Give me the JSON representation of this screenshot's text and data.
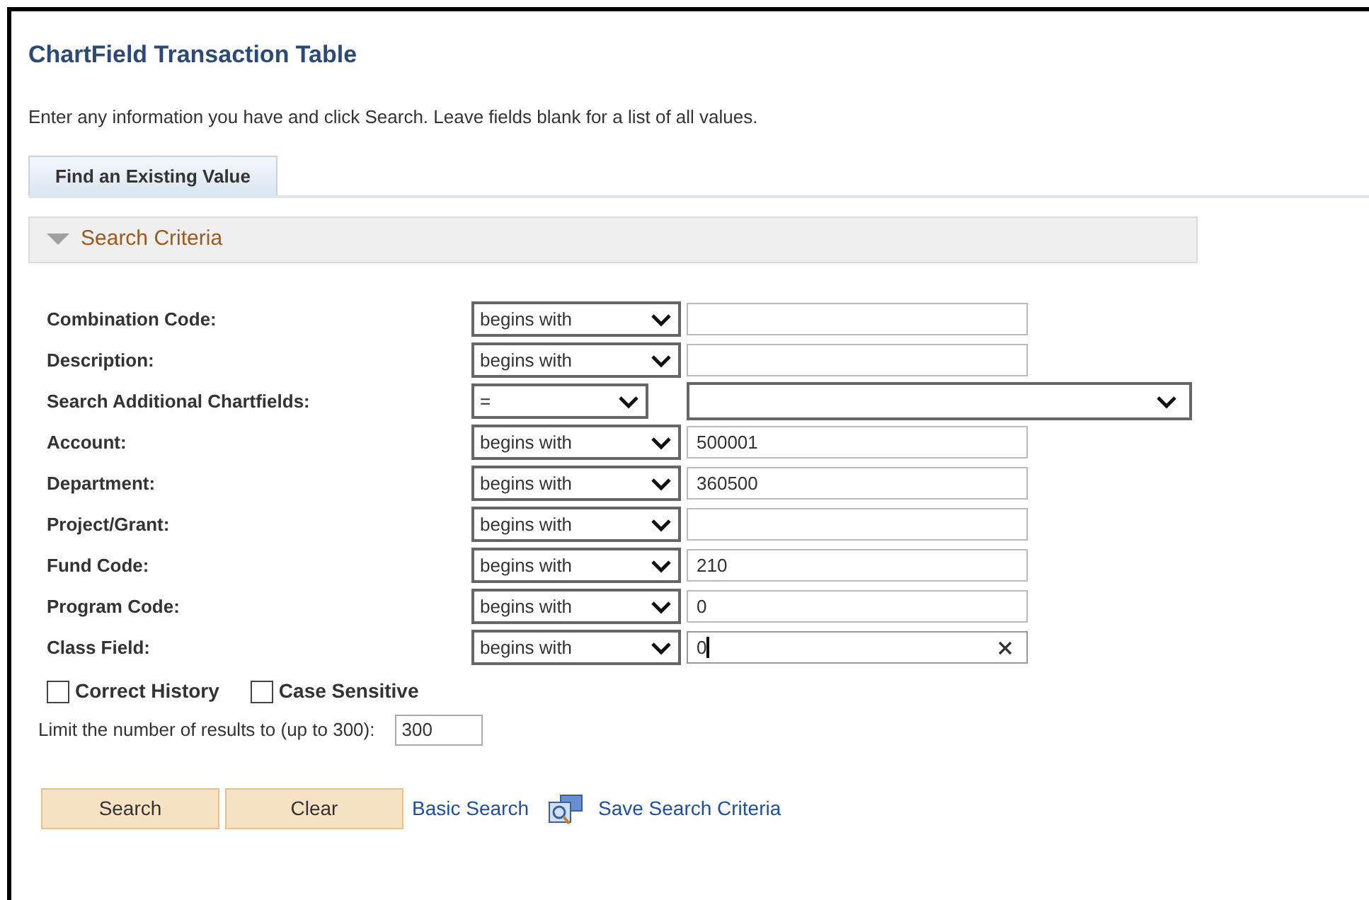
{
  "title": "ChartField Transaction Table",
  "instructions": "Enter any information you have and click Search. Leave fields blank for a list of all values.",
  "tabs": [
    {
      "label": "Find an Existing Value",
      "selected": true
    }
  ],
  "section": {
    "label": "Search Criteria",
    "expanded": true
  },
  "fields": [
    {
      "kind": "text",
      "label": "Combination Code:",
      "operator": "begins with"
    },
    {
      "kind": "text",
      "label": "Description:",
      "operator": "begins with"
    },
    {
      "kind": "dropdown",
      "label": "Search Additional Chartfields:",
      "operator": "="
    },
    {
      "kind": "text",
      "label": "Account:",
      "operator": "begins with",
      "value": "500001"
    },
    {
      "kind": "text",
      "label": "Department:",
      "operator": "begins with",
      "value": "360500"
    },
    {
      "kind": "text",
      "label": "Project/Grant:",
      "operator": "begins with"
    },
    {
      "kind": "text",
      "label": "Fund Code:",
      "operator": "begins with",
      "value": "210"
    },
    {
      "kind": "text",
      "label": "Program Code:",
      "operator": "begins with",
      "value": "0"
    },
    {
      "kind": "text",
      "label": "Class Field:",
      "operator": "begins with",
      "value": "0",
      "focused": true
    }
  ],
  "checkboxes": [
    {
      "label": "Correct History",
      "checked": false
    },
    {
      "label": "Case Sensitive",
      "checked": false
    }
  ],
  "limit": {
    "label": "Limit the number of results to (up to 300):",
    "value": "300"
  },
  "buttons": [
    "Search",
    "Clear"
  ],
  "links": [
    {
      "kind": "text",
      "label": "Basic Search"
    },
    {
      "kind": "icon",
      "label": "Save Search Criteria"
    }
  ]
}
